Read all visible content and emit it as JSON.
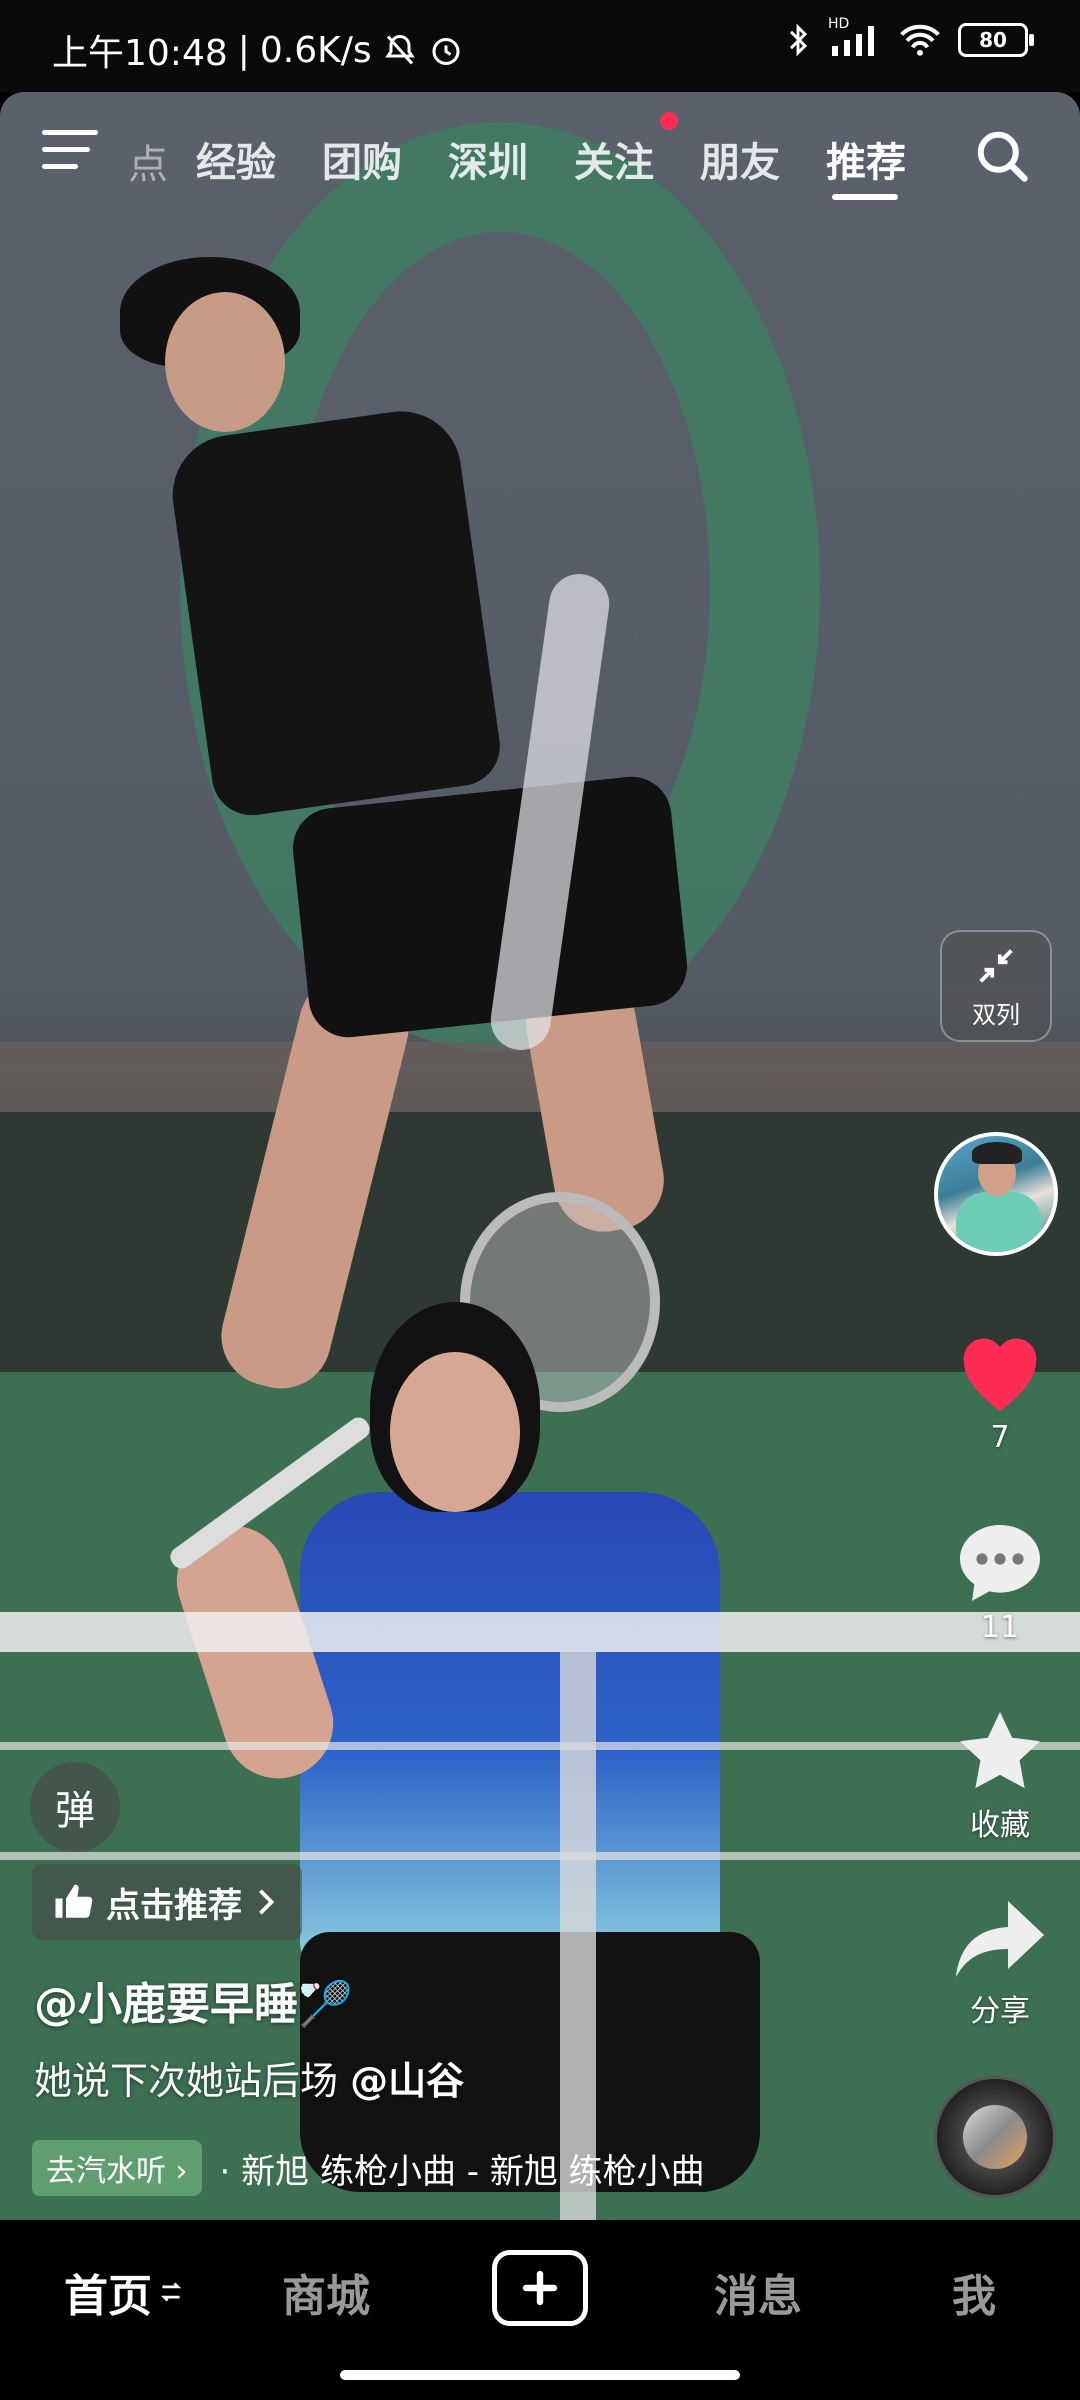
{
  "status_bar": {
    "time": "上午10:48",
    "net_speed": "0.6K/s",
    "signal_badge": "HD",
    "battery": "80"
  },
  "top_nav": {
    "partial_tab": "点",
    "tabs": [
      {
        "label": "经验"
      },
      {
        "label": "团购"
      },
      {
        "label": "深圳"
      },
      {
        "label": "关注"
      },
      {
        "label": "朋友"
      },
      {
        "label": "推荐"
      }
    ],
    "active_tab": "推荐"
  },
  "right_rail": {
    "double_column_label": "双列",
    "like_count": "7",
    "comment_count": "11",
    "collect_label": "收藏",
    "share_label": "分享"
  },
  "overlay": {
    "danmu_label": "弹",
    "recommend_label": "点击推荐",
    "author": "@小鹿要早睡🏸",
    "caption_text": "她说下次她站后场 ",
    "caption_mention": "@山谷",
    "soda_label": "去汽水听",
    "music_track": "· 新旭    练枪小曲 - 新旭    练枪小曲"
  },
  "bottom_nav": {
    "home": "首页",
    "mall": "商城",
    "messages": "消息",
    "me": "我"
  },
  "colors": {
    "accent_red": "#fe2c55",
    "court_green": "#3d6f53"
  }
}
